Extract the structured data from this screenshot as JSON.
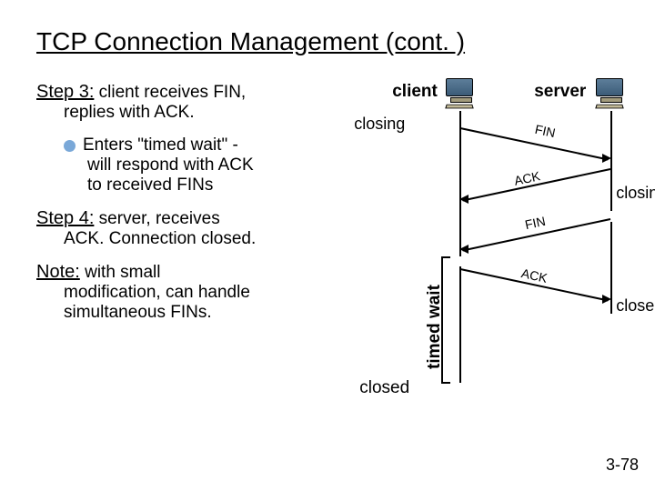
{
  "title": "TCP Connection Management (cont. )",
  "step3": {
    "head": "Step 3:",
    "line1": " client receives FIN,",
    "line2": "replies with ACK.",
    "bullet1": "Enters \"timed wait\" -",
    "bullet2": "will respond with ACK",
    "bullet3": "to received FINs"
  },
  "step4": {
    "head": "Step 4:",
    "line1": " server, receives",
    "line2": "ACK.  Connection closed."
  },
  "note": {
    "head": "Note:",
    "line1": " with small",
    "line2": "modification, can handle",
    "line3": "simultaneous FINs."
  },
  "diagram": {
    "client": "client",
    "server": "server",
    "closing_left": "closing",
    "closing_right": "closing",
    "closed_right": "closed",
    "closed_bottom": "closed",
    "timed_wait": "timed wait",
    "msg_fin1": "FIN",
    "msg_ack1": "ACK",
    "msg_fin2": "FIN",
    "msg_ack2": "ACK"
  },
  "page": "3-78"
}
